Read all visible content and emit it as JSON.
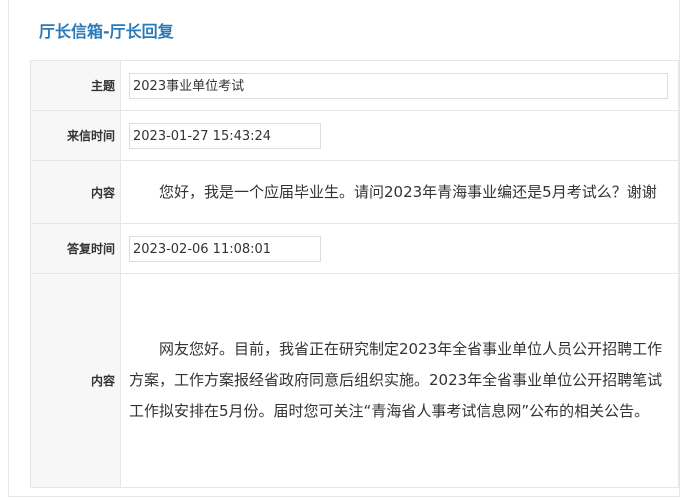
{
  "page": {
    "title": "厅长信箱-厅长回复"
  },
  "letter": {
    "subject_label": "主题",
    "subject": "2023事业单位考试",
    "sent_label": "来信时间",
    "sent_time": "2023-01-27 15:43:24",
    "content_label": "内容",
    "content": "您好，我是一个应届毕业生。请问2023年青海事业编还是5月考试么？谢谢"
  },
  "reply": {
    "time_label": "答复时间",
    "time": "2023-02-06 11:08:01",
    "content_label": "内容",
    "content": "网友您好。目前，我省正在研究制定2023年全省事业单位人员公开招聘工作方案，工作方案报经省政府同意后组织实施。2023年全省事业单位公开招聘笔试工作拟安排在5月份。届时您可关注“青海省人事考试信息网”公布的相关公告。"
  }
}
